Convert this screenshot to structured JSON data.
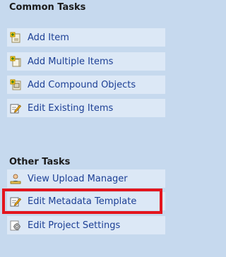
{
  "common_tasks": {
    "header": "Common Tasks",
    "items": [
      {
        "label": "Add Item",
        "icon": "add-item-icon"
      },
      {
        "label": "Add Multiple Items",
        "icon": "add-multiple-items-icon"
      },
      {
        "label": "Add Compound Objects",
        "icon": "add-compound-objects-icon"
      },
      {
        "label": "Edit Existing Items",
        "icon": "edit-existing-items-icon"
      }
    ]
  },
  "other_tasks": {
    "header": "Other Tasks",
    "items": [
      {
        "label": "View Upload Manager",
        "icon": "upload-manager-icon"
      },
      {
        "label": "Edit Metadata Template",
        "icon": "edit-metadata-template-icon"
      },
      {
        "label": "Edit Project Settings",
        "icon": "project-settings-icon"
      }
    ]
  },
  "colors": {
    "panel_background": "#c6d9ee",
    "item_background": "#dce8f6",
    "link_text": "#1c3f95",
    "highlight": "#e4151d"
  }
}
